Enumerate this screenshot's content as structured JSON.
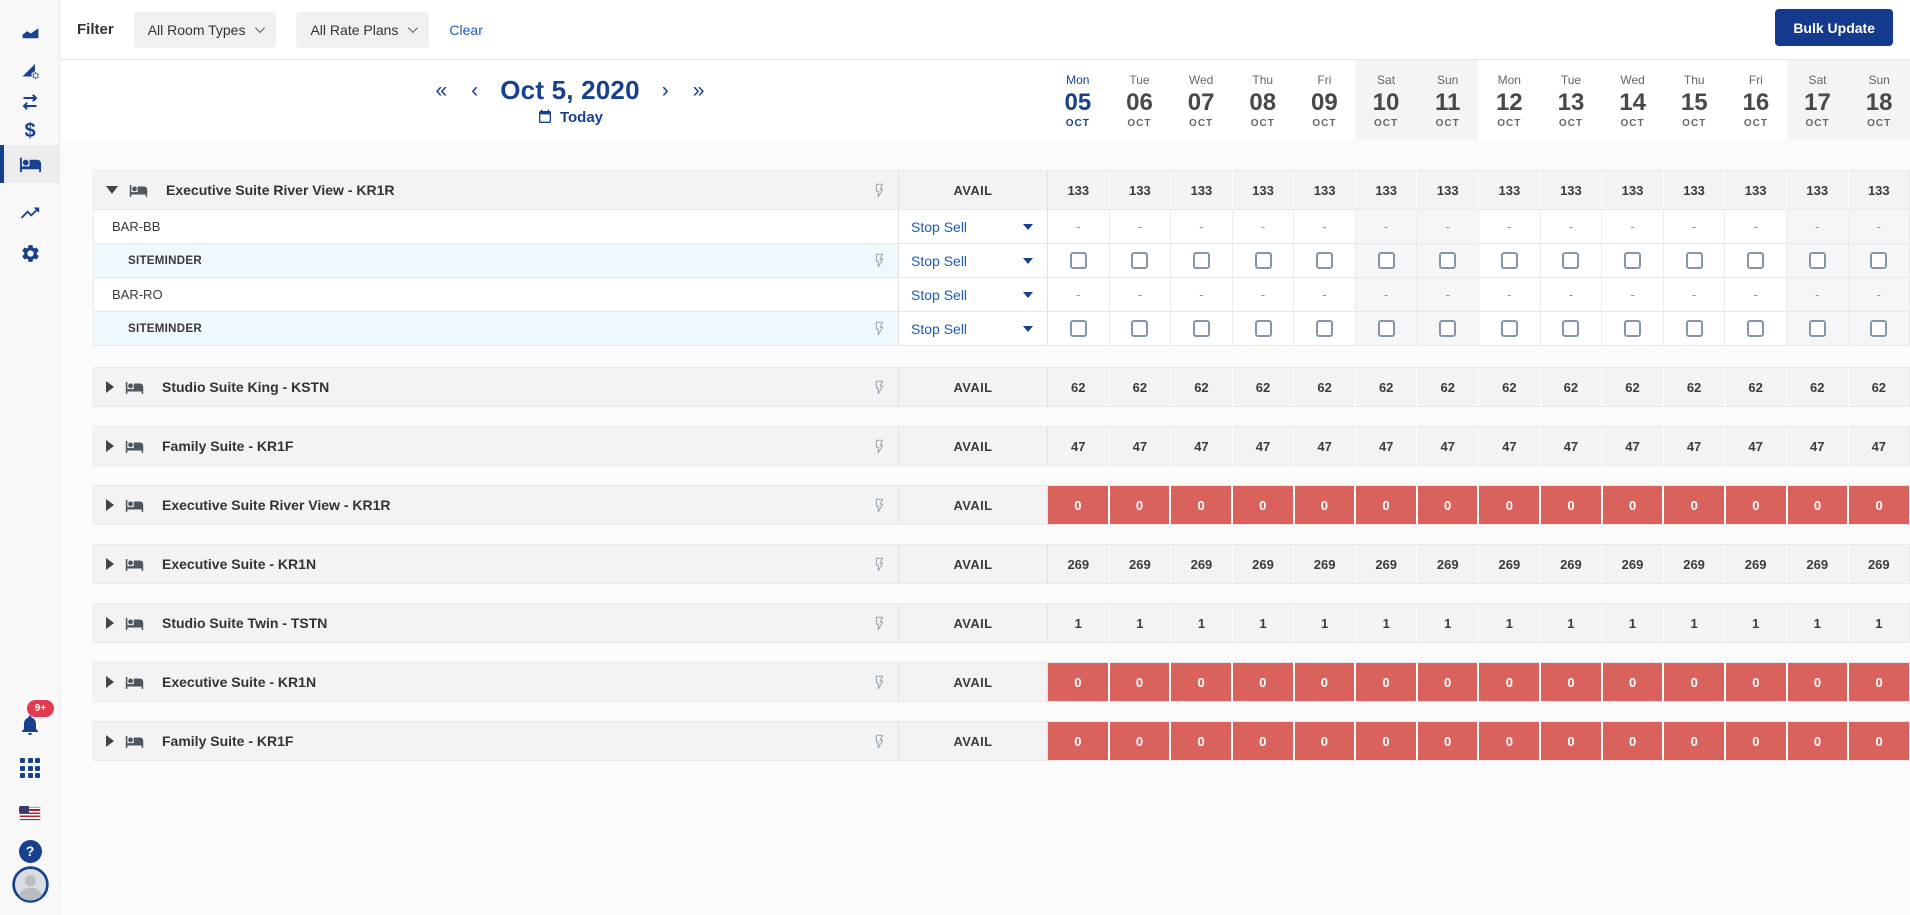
{
  "filter_bar": {
    "label": "Filter",
    "room_types_value": "All Room Types",
    "rate_plans_value": "All Rate Plans",
    "clear_label": "Clear",
    "bulk_update_label": "Bulk Update"
  },
  "date_nav": {
    "first_arrow": "«",
    "prev_arrow": "‹",
    "title": "Oct 5, 2020",
    "next_arrow": "›",
    "last_arrow": "»",
    "today_label": "Today"
  },
  "calendar": {
    "days": [
      {
        "dow": "Mon",
        "date": "05",
        "month": "OCT",
        "today": true,
        "weekend": false
      },
      {
        "dow": "Tue",
        "date": "06",
        "month": "OCT",
        "today": false,
        "weekend": false
      },
      {
        "dow": "Wed",
        "date": "07",
        "month": "OCT",
        "today": false,
        "weekend": false
      },
      {
        "dow": "Thu",
        "date": "08",
        "month": "OCT",
        "today": false,
        "weekend": false
      },
      {
        "dow": "Fri",
        "date": "09",
        "month": "OCT",
        "today": false,
        "weekend": false
      },
      {
        "dow": "Sat",
        "date": "10",
        "month": "OCT",
        "today": false,
        "weekend": true
      },
      {
        "dow": "Sun",
        "date": "11",
        "month": "OCT",
        "today": false,
        "weekend": true
      },
      {
        "dow": "Mon",
        "date": "12",
        "month": "OCT",
        "today": false,
        "weekend": false
      },
      {
        "dow": "Tue",
        "date": "13",
        "month": "OCT",
        "today": false,
        "weekend": false
      },
      {
        "dow": "Wed",
        "date": "14",
        "month": "OCT",
        "today": false,
        "weekend": false
      },
      {
        "dow": "Thu",
        "date": "15",
        "month": "OCT",
        "today": false,
        "weekend": false
      },
      {
        "dow": "Fri",
        "date": "16",
        "month": "OCT",
        "today": false,
        "weekend": false
      },
      {
        "dow": "Sat",
        "date": "17",
        "month": "OCT",
        "today": false,
        "weekend": true
      },
      {
        "dow": "Sun",
        "date": "18",
        "month": "OCT",
        "today": false,
        "weekend": true
      }
    ]
  },
  "sidebar": {
    "top_items": [
      {
        "name": "analytics",
        "active": false
      },
      {
        "name": "reports",
        "active": false
      },
      {
        "name": "channels",
        "active": false
      },
      {
        "name": "rates",
        "active": false
      },
      {
        "name": "inventory",
        "active": true
      },
      {
        "name": "performance",
        "active": false
      },
      {
        "name": "settings",
        "active": false
      }
    ],
    "notification_badge": "9+",
    "bottom_items": [
      {
        "name": "notifications"
      },
      {
        "name": "apps"
      },
      {
        "name": "language-us"
      },
      {
        "name": "help"
      },
      {
        "name": "account"
      }
    ]
  },
  "table": {
    "avail_label": "AVAIL",
    "stop_sell_label": "Stop Sell",
    "groups": [
      {
        "name": "Executive Suite River View - KR1R",
        "expanded": true,
        "style": "normal",
        "values": [
          133,
          133,
          133,
          133,
          133,
          133,
          133,
          133,
          133,
          133,
          133,
          133,
          133,
          133
        ],
        "children": [
          {
            "label": "BAR-BB",
            "kind": "rate",
            "cells": "dash"
          },
          {
            "label": "SITEMINDER",
            "kind": "channel",
            "cells": "checkbox"
          },
          {
            "label": "BAR-RO",
            "kind": "rate",
            "cells": "dash"
          },
          {
            "label": "SITEMINDER",
            "kind": "channel",
            "cells": "checkbox"
          }
        ]
      },
      {
        "name": "Studio Suite King - KSTN",
        "expanded": false,
        "style": "normal",
        "values": [
          62,
          62,
          62,
          62,
          62,
          62,
          62,
          62,
          62,
          62,
          62,
          62,
          62,
          62
        ],
        "children": []
      },
      {
        "name": "Family Suite - KR1F",
        "expanded": false,
        "style": "normal",
        "values": [
          47,
          47,
          47,
          47,
          47,
          47,
          47,
          47,
          47,
          47,
          47,
          47,
          47,
          47
        ],
        "children": []
      },
      {
        "name": "Executive Suite River View - KR1R",
        "expanded": false,
        "style": "alert",
        "values": [
          0,
          0,
          0,
          0,
          0,
          0,
          0,
          0,
          0,
          0,
          0,
          0,
          0,
          0
        ],
        "children": []
      },
      {
        "name": "Executive Suite - KR1N",
        "expanded": false,
        "style": "normal",
        "values": [
          269,
          269,
          269,
          269,
          269,
          269,
          269,
          269,
          269,
          269,
          269,
          269,
          269,
          269
        ],
        "children": []
      },
      {
        "name": "Studio Suite Twin - TSTN",
        "expanded": false,
        "style": "normal",
        "values": [
          1,
          1,
          1,
          1,
          1,
          1,
          1,
          1,
          1,
          1,
          1,
          1,
          1,
          1
        ],
        "children": []
      },
      {
        "name": "Executive Suite - KR1N",
        "expanded": false,
        "style": "alert",
        "values": [
          0,
          0,
          0,
          0,
          0,
          0,
          0,
          0,
          0,
          0,
          0,
          0,
          0,
          0
        ],
        "children": []
      },
      {
        "name": "Family Suite - KR1F",
        "expanded": false,
        "style": "alert",
        "values": [
          0,
          0,
          0,
          0,
          0,
          0,
          0,
          0,
          0,
          0,
          0,
          0,
          0,
          0
        ],
        "children": []
      }
    ]
  }
}
